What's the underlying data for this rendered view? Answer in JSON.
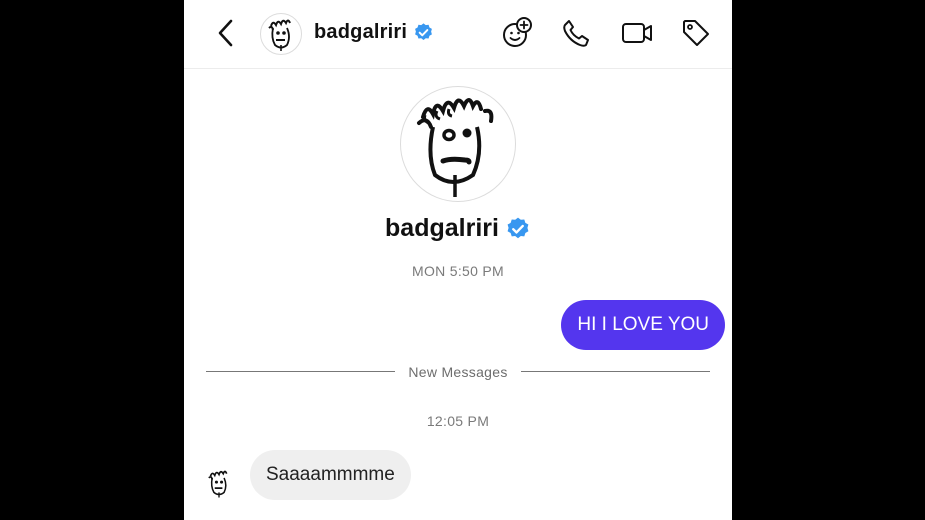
{
  "header": {
    "username": "badgalriri",
    "icons": [
      "back-chevron-icon",
      "verified-badge-icon",
      "add-sticker-icon",
      "phone-icon",
      "video-camera-icon",
      "tag-icon"
    ]
  },
  "profile": {
    "username": "badgalriri",
    "verified": true
  },
  "thread": {
    "timestamp_1": "MON 5:50 PM",
    "divider_label": "New Messages",
    "timestamp_2": "12:05 PM",
    "messages": [
      {
        "direction": "outgoing",
        "text": "HI I LOVE YOU"
      },
      {
        "direction": "incoming",
        "text": "Saaaammmme"
      }
    ]
  },
  "colors": {
    "outgoing_bubble": "#5436ee",
    "incoming_bubble": "#efefef",
    "verified_badge": "#3897f0",
    "backdrop": "#000000"
  }
}
